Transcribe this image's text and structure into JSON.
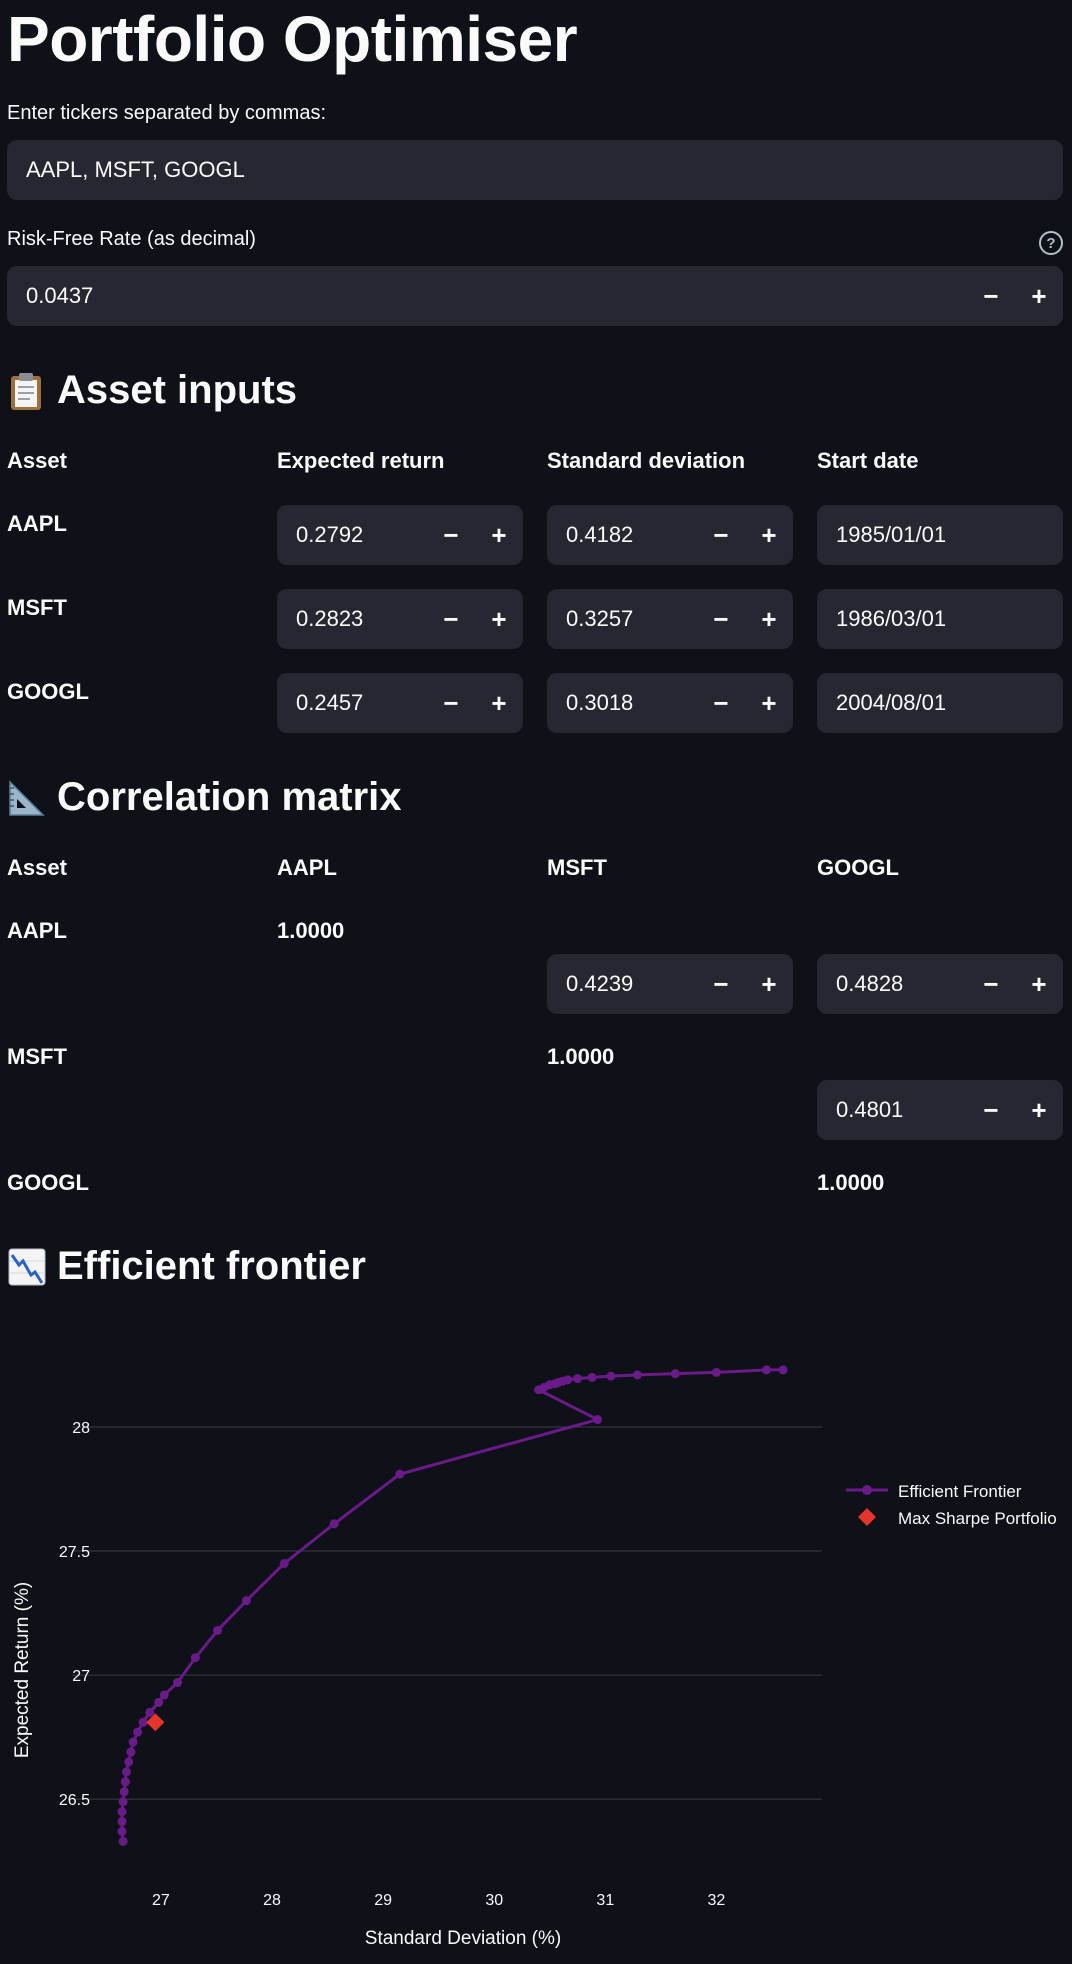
{
  "app": {
    "title": "Portfolio Optimiser"
  },
  "tickers": {
    "label": "Enter tickers separated by commas:",
    "value": "AAPL, MSFT, GOOGL"
  },
  "risk_free": {
    "label": "Risk-Free Rate (as decimal)",
    "value": "0.0437",
    "minus": "−",
    "plus": "+",
    "help": "?"
  },
  "asset_inputs": {
    "heading": "Asset inputs",
    "headers": [
      "Asset",
      "Expected return",
      "Standard deviation",
      "Start date"
    ],
    "rows": [
      {
        "asset": "AAPL",
        "exp_return": "0.2792",
        "std_dev": "0.4182",
        "start_date": "1985/01/01"
      },
      {
        "asset": "MSFT",
        "exp_return": "0.2823",
        "std_dev": "0.3257",
        "start_date": "1986/03/01"
      },
      {
        "asset": "GOOGL",
        "exp_return": "0.2457",
        "std_dev": "0.3018",
        "start_date": "2004/08/01"
      }
    ]
  },
  "correlation": {
    "heading": "Correlation matrix",
    "headers": [
      "Asset",
      "AAPL",
      "MSFT",
      "GOOGL"
    ],
    "rows": [
      "AAPL",
      "MSFT",
      "GOOGL"
    ],
    "diag": "1.0000",
    "aapl_msft": "0.4239",
    "aapl_googl": "0.4828",
    "msft_googl": "0.4801"
  },
  "stepper": {
    "minus": "−",
    "plus": "+"
  },
  "frontier": {
    "heading": "Efficient frontier"
  },
  "colors": {
    "background": "#0e1117",
    "input": "#262730",
    "frontier": "#6b1a8a",
    "max_sharpe": "#e8352b"
  },
  "chart_data": {
    "type": "line",
    "xlabel": "Standard Deviation (%)",
    "ylabel": "Expected Return (%)",
    "xlim": [
      26.2,
      32.95
    ],
    "ylim": [
      26.15,
      28.27
    ],
    "xticks": [
      27,
      28,
      29,
      30,
      31,
      32
    ],
    "yticks": [
      26.5,
      27,
      27.5,
      28
    ],
    "grid": "horizontal",
    "legend_position": "top-right",
    "series": [
      {
        "name": "Efficient Frontier",
        "x": [
          26.66,
          26.65,
          26.65,
          26.65,
          26.66,
          26.67,
          26.68,
          26.69,
          26.71,
          26.73,
          26.75,
          26.79,
          26.84,
          26.9,
          26.98,
          27.03,
          27.15,
          27.31,
          27.51,
          27.77,
          28.11,
          28.56,
          29.15,
          30.93,
          30.4,
          30.45,
          30.5,
          30.55,
          30.58,
          30.62,
          30.66,
          30.75,
          30.88,
          31.05,
          31.29,
          31.63,
          32.0,
          32.45,
          32.6
        ],
        "y": [
          26.33,
          26.37,
          26.41,
          26.45,
          26.49,
          26.53,
          26.57,
          26.61,
          26.65,
          26.69,
          26.73,
          26.77,
          26.81,
          26.85,
          26.89,
          26.92,
          26.97,
          27.07,
          27.18,
          27.3,
          27.45,
          27.61,
          27.81,
          28.03,
          28.15,
          28.16,
          28.17,
          28.175,
          28.18,
          28.185,
          28.19,
          28.195,
          28.2,
          28.205,
          28.21,
          28.215,
          28.22,
          28.23,
          28.23
        ]
      },
      {
        "name": "Max Sharpe Portfolio",
        "x": [
          26.95
        ],
        "y": [
          26.81
        ]
      }
    ]
  }
}
